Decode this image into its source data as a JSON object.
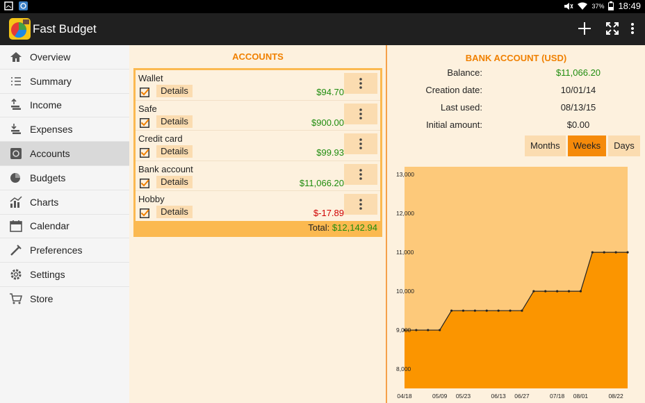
{
  "statusbar": {
    "battery": "37%",
    "time": "18:49"
  },
  "appbar": {
    "title": "Fast Budget",
    "actions": [
      "add-icon",
      "fullscreen-icon",
      "overflow-menu-icon"
    ]
  },
  "sidebar": {
    "items": [
      {
        "label": "Overview",
        "icon": "home-icon"
      },
      {
        "label": "Summary",
        "icon": "list-icon"
      },
      {
        "label": "Income",
        "icon": "income-icon"
      },
      {
        "label": "Expenses",
        "icon": "expenses-icon"
      },
      {
        "label": "Accounts",
        "icon": "safe-icon",
        "active": true
      },
      {
        "label": "Budgets",
        "icon": "budget-icon"
      },
      {
        "label": "Charts",
        "icon": "chart-icon"
      },
      {
        "label": "Calendar",
        "icon": "calendar-icon"
      },
      {
        "label": "Preferences",
        "icon": "preferences-icon"
      },
      {
        "label": "Settings",
        "icon": "gear-icon"
      },
      {
        "label": "Store",
        "icon": "cart-icon"
      }
    ]
  },
  "accounts": {
    "title": "ACCOUNTS",
    "details_label": "Details",
    "rows": [
      {
        "name": "Wallet",
        "amount": "$94.70",
        "negative": false,
        "checked": true
      },
      {
        "name": "Safe",
        "amount": "$900.00",
        "negative": false,
        "checked": true
      },
      {
        "name": "Credit card",
        "amount": "$99.93",
        "negative": false,
        "checked": true
      },
      {
        "name": "Bank account",
        "amount": "$11,066.20",
        "negative": false,
        "checked": true
      },
      {
        "name": "Hobby",
        "amount": "$-17.89",
        "negative": true,
        "checked": true
      }
    ],
    "total_label": "Total:",
    "total_value": "$12,142.94"
  },
  "bank": {
    "title": "BANK ACCOUNT (USD)",
    "balance_label": "Balance:",
    "balance_value": "$11,066.20",
    "creation_label": "Creation date:",
    "creation_value": "10/01/14",
    "last_used_label": "Last used:",
    "last_used_value": "08/13/15",
    "initial_label": "Initial amount:",
    "initial_value": "$0.00",
    "periods": [
      {
        "label": "Months",
        "selected": false
      },
      {
        "label": "Weeks",
        "selected": true
      },
      {
        "label": "Days",
        "selected": false
      }
    ]
  },
  "colors": {
    "accent": "#f08000",
    "positive": "#1f8c0e",
    "negative": "#d00000",
    "chart_fill": "#fb9500",
    "chart_bg": "#fdc97a"
  },
  "chart_data": {
    "type": "area",
    "title": "",
    "xlabel": "",
    "ylabel": "",
    "ylim": [
      7500,
      13200
    ],
    "yticks": [
      8000,
      9000,
      10000,
      11000,
      12000,
      13000
    ],
    "ytick_labels": [
      "8,000",
      "9,000",
      "10,000",
      "11,000",
      "12,000",
      "13,000"
    ],
    "xtick_labels": [
      "04/18",
      "05/09",
      "05/23",
      "06/13",
      "06/27",
      "07/18",
      "08/01",
      "08/22"
    ],
    "xtick_index": [
      0,
      3,
      5,
      8,
      10,
      13,
      15,
      18
    ],
    "x": [
      "04/18",
      "04/25",
      "05/02",
      "05/09",
      "05/16",
      "05/23",
      "05/30",
      "06/06",
      "06/13",
      "06/20",
      "06/27",
      "07/04",
      "07/11",
      "07/18",
      "07/25",
      "08/01",
      "08/08",
      "08/15",
      "08/22",
      "08/29"
    ],
    "values": [
      9000,
      9000,
      9000,
      9000,
      9500,
      9500,
      9500,
      9500,
      9500,
      9500,
      9500,
      10000,
      10000,
      10000,
      10000,
      10000,
      11000,
      11000,
      11000,
      11000
    ]
  }
}
